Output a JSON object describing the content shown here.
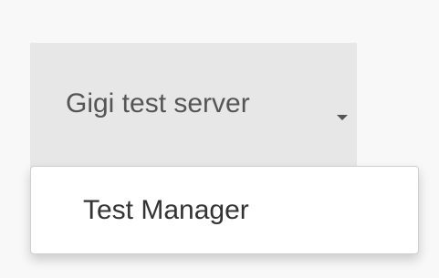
{
  "nav": {
    "server_dropdown": {
      "label": "Gigi test server",
      "caret_icon": "caret-down-icon",
      "menu_items": [
        {
          "label": "Test Manager"
        }
      ]
    }
  },
  "colors": {
    "page_background": "#f8f8f8",
    "toggle_background": "#e7e7e7",
    "toggle_text": "#555555",
    "menu_background": "#ffffff",
    "menu_text": "#333333"
  }
}
